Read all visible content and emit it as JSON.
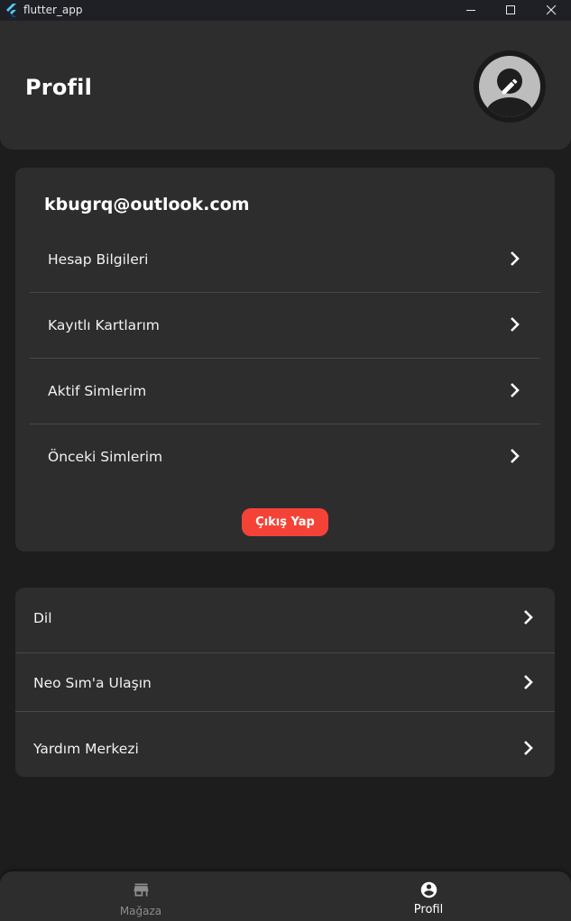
{
  "window": {
    "title": "flutter_app"
  },
  "header": {
    "title": "Profil"
  },
  "account": {
    "email": "kbugrq@outlook.com",
    "items": [
      {
        "label": "Hesap Bilgileri"
      },
      {
        "label": "Kayıtlı Kartlarım"
      },
      {
        "label": "Aktif Simlerim"
      },
      {
        "label": "Önceki Simlerim"
      }
    ],
    "logout_label": "Çıkış Yap"
  },
  "settings": {
    "items": [
      {
        "label": "Dil"
      },
      {
        "label": "Neo Sım'a Ulaşın"
      },
      {
        "label": "Yardım Merkezi"
      }
    ]
  },
  "bottom_nav": {
    "items": [
      {
        "label": "Mağaza",
        "icon": "store-icon",
        "active": false
      },
      {
        "label": "Profil",
        "icon": "account-circle-icon",
        "active": true
      }
    ]
  },
  "colors": {
    "background": "#1d1d1d",
    "surface": "#2d2d2d",
    "accent_danger": "#f44336",
    "divider": "#474747",
    "inactive_text": "#8c8c8c"
  }
}
